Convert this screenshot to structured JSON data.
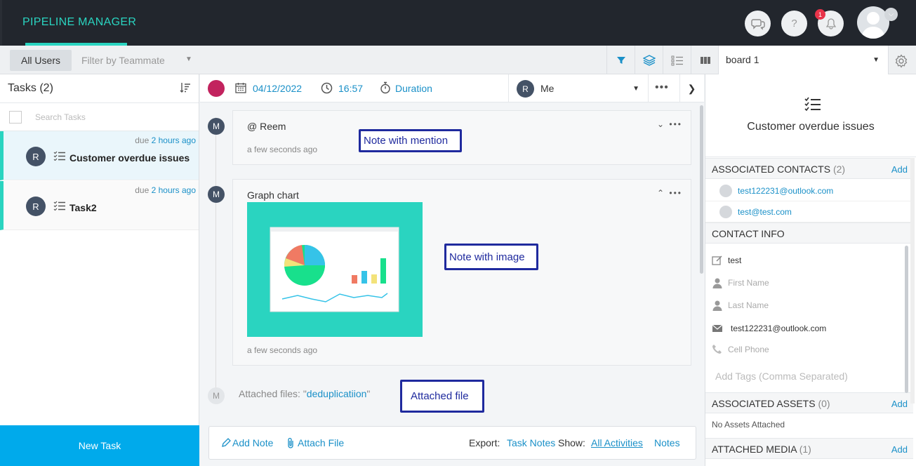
{
  "topbar": {
    "brand": "PIPELINE MANAGER",
    "notification_count": "1",
    "icons": [
      "chat-icon",
      "help-icon",
      "bell-icon",
      "user-avatar"
    ]
  },
  "subbar": {
    "all_users": "All Users",
    "filter_teammate": "Filter by Teammate",
    "board": "board 1"
  },
  "tasks": {
    "title": "Tasks (2)",
    "search_placeholder": "Search Tasks",
    "items": [
      {
        "due_prefix": "due",
        "due_ago": "2 hours ago",
        "avatar": "R",
        "name": "Customer overdue issues"
      },
      {
        "due_prefix": "due",
        "due_ago": "2 hours ago",
        "avatar": "R",
        "name": "Task2"
      }
    ],
    "new_task": "New Task"
  },
  "detail": {
    "color": "#c2235e",
    "date": "04/12/2022",
    "time": "16:57",
    "duration": "Duration",
    "assignee_avatar": "R",
    "assignee": "Me"
  },
  "timeline": {
    "notes": [
      {
        "avatar": "M",
        "title": "@ Reem",
        "time": "a few seconds ago"
      },
      {
        "avatar": "M",
        "title": "Graph chart",
        "time": "a few seconds ago"
      }
    ],
    "attached_avatar": "M",
    "attached_prefix": "Attached files: \"",
    "attached_file": "deduplicatiion",
    "attached_suffix": "\""
  },
  "annotations": {
    "mention": "Note with mention",
    "image": "Note with image",
    "file": "Attached file"
  },
  "footer": {
    "add_note": "Add Note",
    "attach_file": "Attach File",
    "export": "Export:",
    "task_notes": "Task Notes",
    "show": "Show:",
    "all_activities": "All Activities",
    "notes": "Notes"
  },
  "right": {
    "title": "Customer overdue issues",
    "contacts_label": "ASSOCIATED CONTACTS",
    "contacts_count": "(2)",
    "add": "Add",
    "contacts": [
      "test122231@outlook.com",
      "test@test.com"
    ],
    "contact_info_label": "CONTACT INFO",
    "info": {
      "name": "test",
      "first_name": "First Name",
      "last_name": "Last Name",
      "email": "test122231@outlook.com",
      "cell_phone": "Cell Phone"
    },
    "tags_placeholder": "Add Tags (Comma Separated)",
    "assets_label": "ASSOCIATED ASSETS",
    "assets_count": "(0)",
    "no_assets": "No Assets Attached",
    "media_label": "ATTACHED MEDIA",
    "media_count": "(1)"
  },
  "colors": {
    "accent": "#2ad4c0",
    "link": "#1a90c8",
    "primary_button": "#00aaeb",
    "topbar": "#22262d",
    "annotation": "#1f2a9e"
  }
}
